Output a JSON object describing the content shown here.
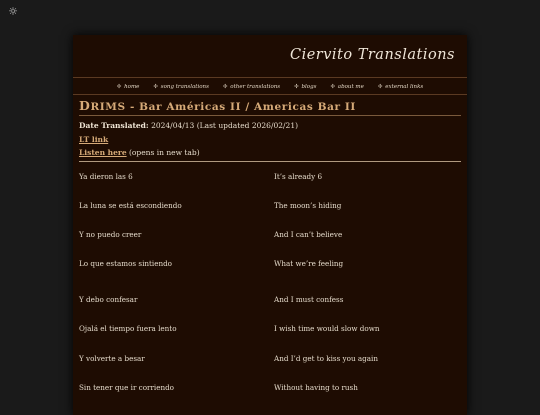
{
  "theme_toggle": {
    "icon": "sun-icon",
    "glyph": "☼"
  },
  "site": {
    "title": "Ciervito Translations"
  },
  "nav": {
    "items": [
      {
        "star": "✢",
        "label": "home"
      },
      {
        "star": "✢",
        "label": "song translations"
      },
      {
        "star": "✢",
        "label": "other translations"
      },
      {
        "star": "✢",
        "label": "blogs"
      },
      {
        "star": "✢",
        "label": "about me"
      },
      {
        "star": "✢",
        "label": "external links"
      }
    ]
  },
  "song": {
    "title_initial": "D",
    "title_rest": "RIMS - Bar Américas II / Americas Bar II",
    "date_label": "Date Translated:",
    "date_value": "2024/04/13 (Last updated 2026/02/21)",
    "lt_link": "LT link",
    "listen_link": "Listen here",
    "listen_note": "(opens in new tab)"
  },
  "lyrics": [
    {
      "es": "Ya dieron las 6",
      "en": "It’s already 6"
    },
    {
      "es": "La luna se está escondiendo",
      "en": "The moon’s hiding"
    },
    {
      "es": "Y no puedo creer",
      "en": "And I can’t believe"
    },
    {
      "es": "Lo que estamos sintiendo",
      "en": "What we’re feeling"
    },
    {
      "es": "Y debo confesar",
      "en": "And I must confess"
    },
    {
      "es": "Ojalá el tiempo fuera lento",
      "en": "I wish time would slow down"
    },
    {
      "es": "Y volverte a besar",
      "en": "And I’d get to kiss you again"
    },
    {
      "es": "Sin tener que ir corriendo",
      "en": "Without having to rush"
    }
  ]
}
